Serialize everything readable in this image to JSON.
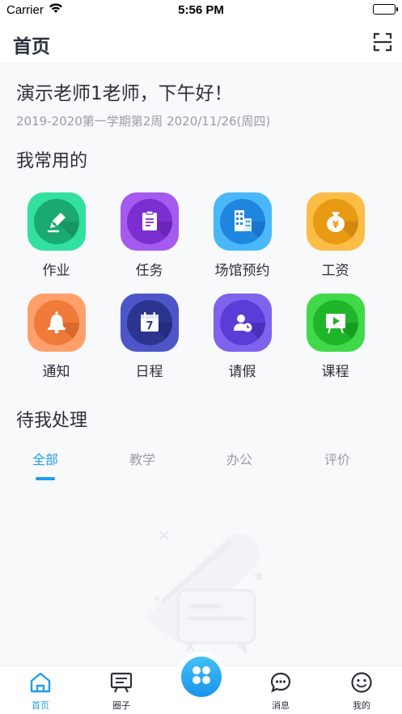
{
  "status_bar": {
    "carrier": "Carrier",
    "time": "5:56 PM"
  },
  "nav": {
    "title": "首页",
    "scan_icon": "scan-icon"
  },
  "greeting": "演示老师1老师，下午好！",
  "semester": "2019-2020第一学期第2周 2020/11/26(周四)",
  "frequent": {
    "title": "我常用的",
    "apps": [
      {
        "label": "作业",
        "icon": "pen-icon",
        "color": "#22c98a"
      },
      {
        "label": "任务",
        "icon": "clipboard-icon",
        "color": "#8e3fe0"
      },
      {
        "label": "场馆预约",
        "icon": "building-icon",
        "color": "#2a9ef5"
      },
      {
        "label": "工资",
        "icon": "money-bag-icon",
        "color": "#f5a623"
      },
      {
        "label": "通知",
        "icon": "bell-icon",
        "color": "#f5874a"
      },
      {
        "label": "日程",
        "icon": "calendar-icon",
        "color": "#3a46b8",
        "calendar_day": "7"
      },
      {
        "label": "请假",
        "icon": "leave-icon",
        "color": "#6a4fe0"
      },
      {
        "label": "课程",
        "icon": "play-board-icon",
        "color": "#2bc43a"
      }
    ]
  },
  "pending": {
    "title": "待我处理",
    "tabs": [
      "全部",
      "教学",
      "办公",
      "评价"
    ],
    "active_tab": 0
  },
  "tab_bar": {
    "items": [
      {
        "label": "首页",
        "icon": "home-icon",
        "active": true
      },
      {
        "label": "圈子",
        "icon": "board-icon",
        "active": false
      },
      {
        "label": "消息",
        "icon": "chat-icon",
        "active": false
      },
      {
        "label": "我的",
        "icon": "smile-icon",
        "active": false
      }
    ],
    "center_icon": "apps-grid-icon"
  },
  "colors": {
    "accent": "#1f9cf0",
    "text": "#2b2f3a",
    "muted": "#9a9ca3"
  }
}
